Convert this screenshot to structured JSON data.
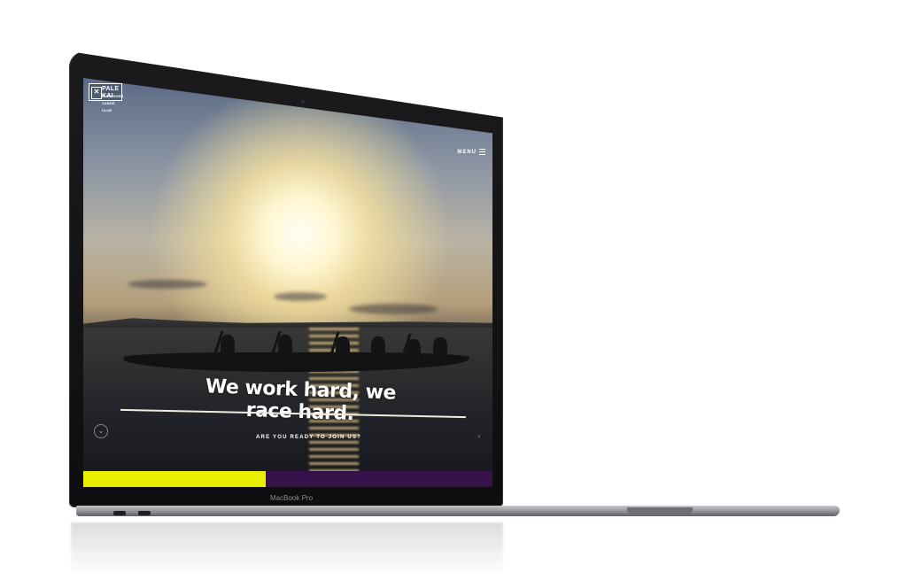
{
  "site": {
    "logo_title": "PALE KAI",
    "logo_subtitle": "OUTRIGGER CANOE CLUB",
    "menu_label": "MENU",
    "headline": "We work hard, we race hard.",
    "cta": "ARE YOU READY TO JOIN US?"
  },
  "device": {
    "brand_label": "MacBook Pro"
  },
  "colors": {
    "accent_yellow": "#e8f000",
    "accent_purple": "#35134a",
    "text": "#ffffff"
  },
  "icons": {
    "menu": "hamburger-icon",
    "scroll": "chevron-down-icon",
    "logo_mark": "x-mark-icon"
  }
}
